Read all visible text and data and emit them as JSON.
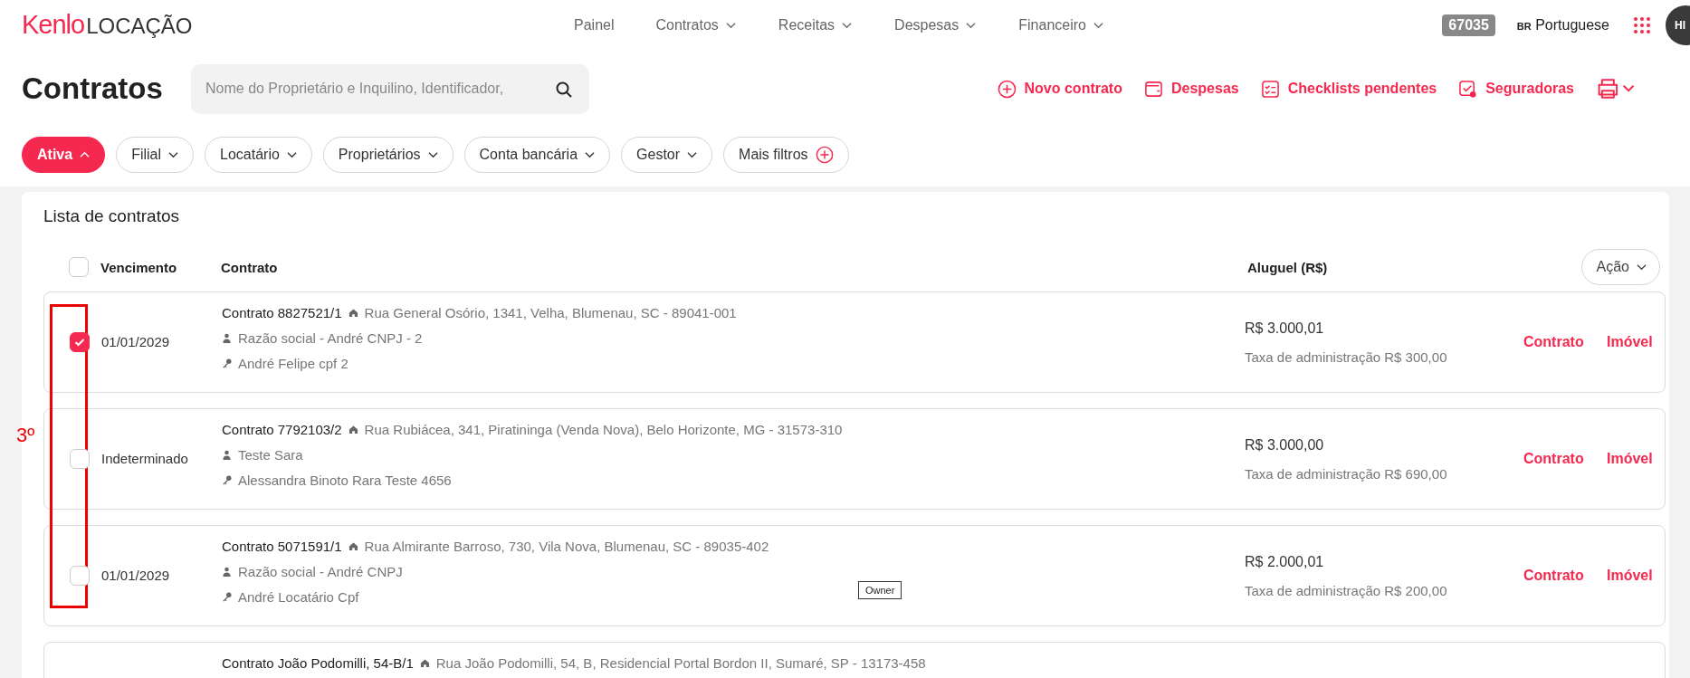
{
  "header": {
    "logo": {
      "brand": "Kenlo",
      "product": "LOCAÇÃO"
    },
    "nav": [
      {
        "label": "Painel",
        "dropdown": false
      },
      {
        "label": "Contratos",
        "dropdown": true
      },
      {
        "label": "Receitas",
        "dropdown": true
      },
      {
        "label": "Despesas",
        "dropdown": true
      },
      {
        "label": "Financeiro",
        "dropdown": true
      }
    ],
    "badge": "67035",
    "language": {
      "flag": "BR",
      "label": "Portuguese"
    },
    "avatar": "HI"
  },
  "toolbar": {
    "title": "Contratos",
    "search": {
      "placeholder": "Nome do Proprietário e Inquilino, Identificador,"
    },
    "actions": [
      {
        "label": "Novo contrato",
        "kind": "add"
      },
      {
        "label": "Despesas",
        "kind": "wallet"
      },
      {
        "label": "Checklists pendentes",
        "kind": "checklist"
      },
      {
        "label": "Seguradoras",
        "kind": "insurer"
      },
      {
        "kind": "print"
      }
    ]
  },
  "filters": [
    {
      "label": "Ativa",
      "kind": "dropdown",
      "selected": true
    },
    {
      "label": "Filial",
      "kind": "dropdown",
      "selected": false
    },
    {
      "label": "Locatário",
      "kind": "dropdown",
      "selected": false
    },
    {
      "label": "Proprietários",
      "kind": "dropdown",
      "selected": false
    },
    {
      "label": "Conta bancária",
      "kind": "dropdown",
      "selected": false
    },
    {
      "label": "Gestor",
      "kind": "dropdown",
      "selected": false
    },
    {
      "label": "Mais filtros",
      "kind": "add",
      "selected": false
    }
  ],
  "list": {
    "title": "Lista de contratos",
    "select_all": {
      "checked": false
    },
    "columns": [
      "Vencimento",
      "Contrato",
      "Aluguel (R$)"
    ],
    "action_button": "Ação",
    "rows": [
      {
        "checked": true,
        "due": "01/01/2029",
        "contract": "Contrato 8827521/1",
        "address": "Rua General Osório, 1341, Velha, Blumenau, SC - 89041-001",
        "owner": "Razão social - André CNPJ - 2",
        "tenant": "André Felipe cpf 2",
        "rent": "R$ 3.000,01",
        "fee": "Taxa de administração R$ 300,00",
        "links": [
          "Contrato",
          "Imóvel"
        ]
      },
      {
        "checked": false,
        "due": "Indeterminado",
        "contract": "Contrato 7792103/2",
        "address": "Rua Rubiácea, 341, Piratininga (Venda Nova), Belo Horizonte, MG - 31573-310",
        "owner": "Teste Sara",
        "tenant": "Alessandra Binoto Rara Teste 4656",
        "rent": "R$ 3.000,00",
        "fee": "Taxa de administração R$ 690,00",
        "links": [
          "Contrato",
          "Imóvel"
        ]
      },
      {
        "checked": false,
        "due": "01/01/2029",
        "contract": "Contrato 5071591/1",
        "address": "Rua Almirante Barroso, 730, Vila Nova, Blumenau, SC - 89035-402",
        "owner": "Razão social - André CNPJ",
        "tenant": "André Locatário Cpf",
        "rent": "R$ 2.000,01",
        "fee": "Taxa de administração R$ 200,00",
        "links": [
          "Contrato",
          "Imóvel"
        ]
      },
      {
        "contract": "Contrato João Podomilli, 54-B/1",
        "address": "Rua João Podomilli, 54, B, Residencial Portal Bordon II, Sumaré, SP - 13173-458"
      }
    ]
  },
  "annotation": {
    "label": "3º"
  },
  "tooltip": "Owner"
}
